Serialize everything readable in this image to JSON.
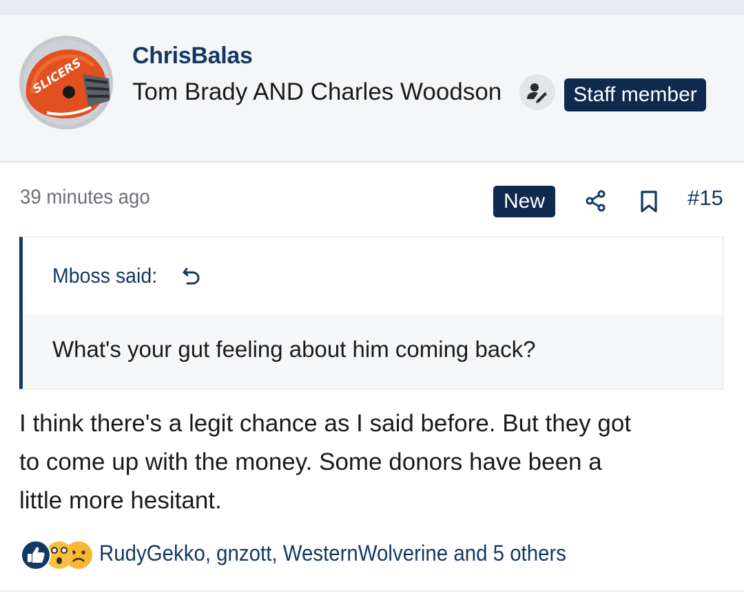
{
  "author": {
    "username": "ChrisBalas",
    "user_title": "Tom Brady AND Charles Woodson",
    "staff_badge": "Staff member",
    "avatar_icon": "helmet-avatar-icon",
    "avatar_text": "SLICERS"
  },
  "post_meta": {
    "timestamp": "39 minutes ago",
    "new_badge": "New",
    "post_number": "#15"
  },
  "quote": {
    "author_label": "Mboss said:",
    "text": "What's your gut feeling about him coming back?"
  },
  "post": {
    "lines": [
      "I think there's a legit chance as I said before. But they got",
      "to come up with the money. Some donors have been a",
      "little more hesitant."
    ]
  },
  "reactions": {
    "icons": [
      "like-icon",
      "wow-icon",
      "sad-icon"
    ],
    "summary": "RudyGekko, gnzott, WesternWolverine and 5 others"
  },
  "colors": {
    "accent_navy": "#0f2a4d",
    "link_blue": "#143864",
    "header_bg": "#f5f6f8"
  }
}
